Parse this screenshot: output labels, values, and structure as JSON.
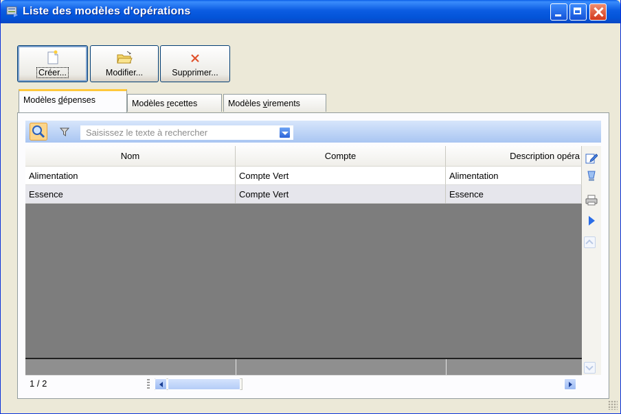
{
  "window": {
    "title": "Liste des modèles d'opérations"
  },
  "toolbar": {
    "create_label": "Créer...",
    "modify_label": "Modifier...",
    "delete_label": "Supprimer..."
  },
  "tabs": [
    {
      "pre": "Modèles ",
      "key": "d",
      "post": "épenses",
      "active": true
    },
    {
      "pre": "Modèles ",
      "key": "r",
      "post": "ecettes",
      "active": false
    },
    {
      "pre": "Modèles ",
      "key": "v",
      "post": "irements",
      "active": false
    }
  ],
  "search": {
    "placeholder": "Saisissez le texte à rechercher"
  },
  "table": {
    "columns": [
      "Nom",
      "Compte",
      "Description opéra"
    ],
    "rows": [
      [
        "Alimentation",
        "Compte Vert",
        "Alimentation"
      ],
      [
        "Essence",
        "Compte Vert",
        "Essence"
      ]
    ]
  },
  "status": {
    "page_count": "1 / 2"
  },
  "icons": [
    "app-icon",
    "new-document-icon",
    "open-folder-icon",
    "delete-x-icon",
    "search-icon",
    "filter-icon",
    "edit-icon",
    "export-icon",
    "print-icon",
    "play-icon"
  ]
}
